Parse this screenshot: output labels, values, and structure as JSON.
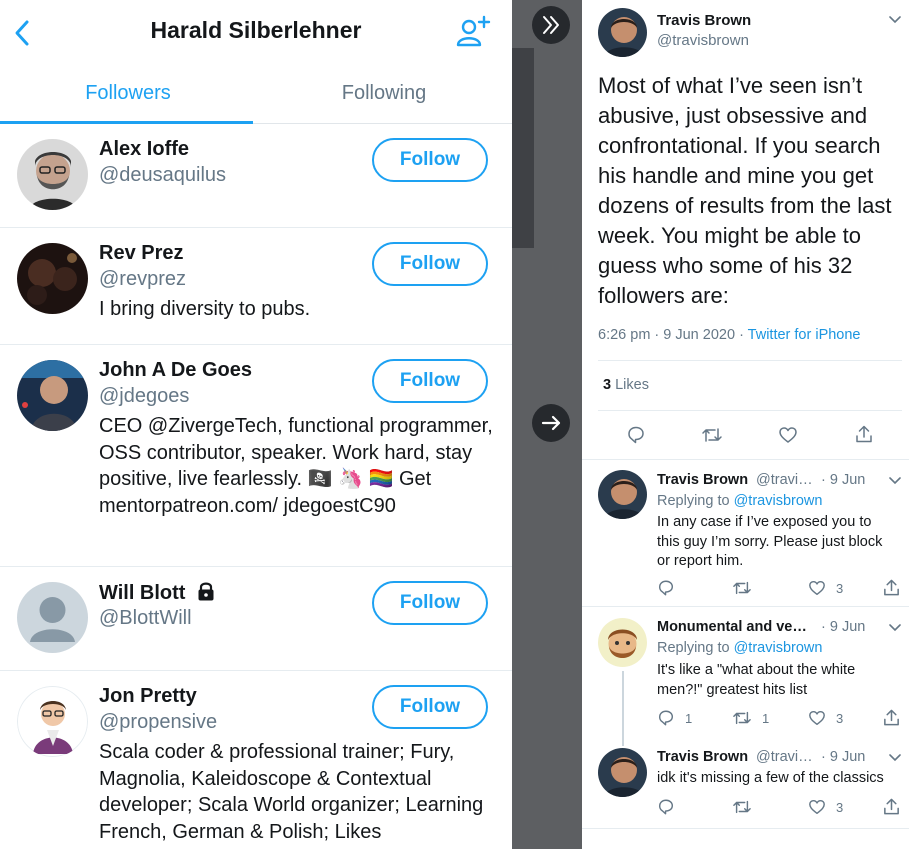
{
  "left": {
    "title": "Harald Silberlehner",
    "tabs": [
      "Followers",
      "Following"
    ],
    "follow_label": "Follow",
    "followers": [
      {
        "name": "Alex Ioffe",
        "handle": "@deusaquilus",
        "bio": ""
      },
      {
        "name": "Rev Prez",
        "handle": "@revprez",
        "bio": "I bring diversity to pubs."
      },
      {
        "name": "John A De Goes",
        "handle": "@jdegoes",
        "bio": "CEO @ZivergeTech, functional programmer, OSS contributor, speaker. Work hard, stay positive, live fearlessly. 🏴‍☠️ 🦄 🏳️‍🌈 Get mentorpatreon.com/ jdegoestC90"
      },
      {
        "name": "Will Blott",
        "handle": "@BlottWill",
        "bio": ""
      },
      {
        "name": "Jon Pretty",
        "handle": "@propensive",
        "bio": "Scala coder & professional trainer; Fury, Magnolia, Kaleidoscope & Contextual developer; Scala World organizer; Learning French, German & Polish; Likes"
      }
    ]
  },
  "tweet": {
    "name": "Travis Brown",
    "handle": "@travisbrown",
    "text": "Most of what I’ve seen isn’t abusive, just obsessive and confrontational. If you search his handle and mine you get dozens of results from the last week. You might be able to guess who some of his 32 followers are:",
    "time": "6:26 pm · 9 Jun 2020 · ",
    "source": "Twitter for iPhone",
    "likes_count": "3",
    "likes_label": "Likes"
  },
  "replies": [
    {
      "name": "Travis Brown",
      "handle": "@travi…",
      "date": "· 9 Jun",
      "replying_label": "Replying to ",
      "replying_to": "@travisbrown",
      "text": "In any case if I’ve exposed you to this guy I’m sorry. Please just block or report him.",
      "replies": "",
      "retweets": "",
      "likes": "3"
    },
    {
      "name": "Monumental and ve…",
      "handle": "",
      "date": "· 9 Jun",
      "replying_label": "Replying to ",
      "replying_to": "@travisbrown",
      "text": "It's like a \"what about the white men?!\" greatest hits list",
      "replies": "1",
      "retweets": "1",
      "likes": "3"
    },
    {
      "name": "Travis Brown",
      "handle": "@travi…",
      "date": "· 9 Jun",
      "replying_label": "",
      "replying_to": "",
      "text": "idk it's missing a few of the classics",
      "replies": "",
      "retweets": "",
      "likes": "3"
    }
  ],
  "colors": {
    "accent": "#1da1f2",
    "muted": "#657786",
    "divider": "#5d5f62"
  }
}
